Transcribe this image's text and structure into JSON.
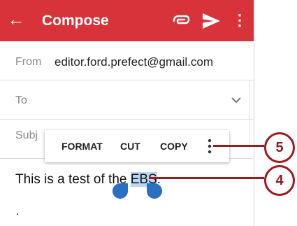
{
  "appbar": {
    "back_icon": "arrow-left-icon",
    "back_glyph": "←",
    "title": "Compose",
    "attach_icon": "paperclip-icon",
    "send_icon": "send-icon",
    "more_icon": "more-vert-icon",
    "more_glyph": "⋮",
    "color": "#d8333a"
  },
  "form": {
    "from_label": "From",
    "from_value": "editor.ford.prefect@gmail.com",
    "to_label": "To",
    "to_dropdown_icon": "chevron-down-icon",
    "subject_label": "Subj"
  },
  "selection_menu": {
    "format": "FORMAT",
    "cut": "CUT",
    "copy": "COPY",
    "more_icon": "more-vert-icon"
  },
  "body": {
    "text_before": "This is a test of the ",
    "selected_text": "EBS",
    "text_after": ".",
    "second_line": ".",
    "selection_color": "#b9d7f4",
    "handle_color": "#2a6fc0"
  },
  "callouts": [
    {
      "number": "5"
    },
    {
      "number": "4"
    }
  ],
  "callout_color": "#9b1b1f"
}
